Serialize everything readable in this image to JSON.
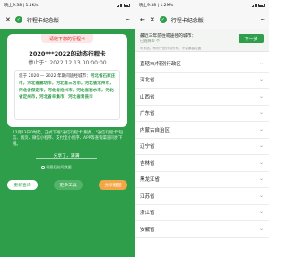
{
  "left": {
    "status_time": "晚上9:38 | 1.1K/s",
    "title": "行程卡纪念版",
    "card": {
      "tab": "请收下您的行程卡",
      "date_range": "2020***2022的动态行程卡",
      "stop_label": "停止于：2022.12.13 00:00:00",
      "note_prefix": "您于 2020 — 2022 年期间途经城市：",
      "note_cities": "河北省石家庄市，河北省廊坊市，河北省三河市，河北省沧州市，河北省保定市，河北省沧州市，河北省衡水市，河北省定州市，河北省辛集市，河北省青县市",
      "note_suffix": ""
    },
    "info": "12月13日0时起，正式下线\"通信行程卡\"服务，\"通信行程卡\"短信、网页、微信小程序、支付宝小程序、APP等查询渠道同步下线。",
    "share_text": "分享了，满满",
    "agree_text": "同意后访问数据",
    "buttons": {
      "query": "重新查询",
      "more": "更多工具",
      "share": "分享截图"
    }
  },
  "right": {
    "status_time": "晚上9:38 | 1.2M/s",
    "title": "行程卡纪念版",
    "notice_title": "最近三年前往或途径的城市：",
    "notice_sub": "已选择 0 个",
    "notice_hint": "可多选，有利于统计和分享，不会暴露位置",
    "next_button": "下一步",
    "provinces": [
      "直辖市/特别行政区",
      "河北省",
      "山西省",
      "广东省",
      "内蒙古自治区",
      "辽宁省",
      "吉林省",
      "黑龙江省",
      "江苏省",
      "浙江省",
      "安徽省"
    ]
  },
  "colors": {
    "brand_green": "#2f9e4b",
    "accent_orange": "#f3a645",
    "alert_red": "#d42c2c"
  },
  "icons": {
    "close": "close-icon",
    "back": "back-arrow-icon",
    "shield": "shield-icon",
    "more": "more-icon",
    "chevron": "chevron-down-icon"
  }
}
